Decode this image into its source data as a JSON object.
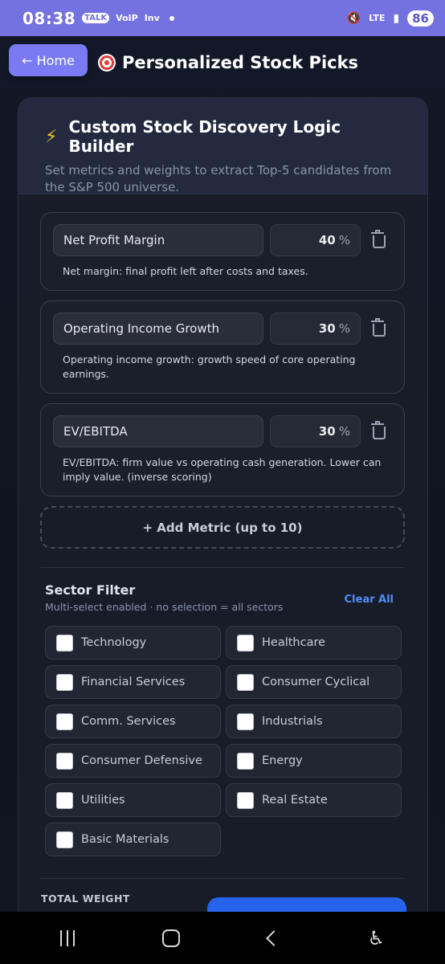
{
  "status_bar": {
    "time": "08:38",
    "notif_icons": [
      "TALK",
      "VoIP",
      "Inv"
    ],
    "network": "LTE",
    "battery": "86"
  },
  "header": {
    "home_label": "← Home",
    "title": "Personalized Stock Picks",
    "title_icon": "target-emoji"
  },
  "builder": {
    "title": "Custom Stock Discovery Logic Builder",
    "title_icon": "lightning-emoji",
    "subtitle": "Set metrics and weights to extract Top-5 candidates from the S&P 500 universe."
  },
  "metrics": [
    {
      "name": "Net Profit Margin",
      "weight": "40",
      "unit": "%",
      "description": "Net margin: final profit left after costs and taxes."
    },
    {
      "name": "Operating Income Growth",
      "weight": "30",
      "unit": "%",
      "description": "Operating income growth: growth speed of core operating earnings."
    },
    {
      "name": "EV/EBITDA",
      "weight": "30",
      "unit": "%",
      "description": "EV/EBITDA: firm value vs operating cash generation. Lower can imply value. (inverse scoring)"
    }
  ],
  "add_metric_label": "+ Add Metric (up to 10)",
  "sector_filter": {
    "title": "Sector Filter",
    "subtitle": "Multi-select enabled · no selection = all sectors",
    "clear_label": "Clear All",
    "sectors": [
      {
        "label": "Technology",
        "checked": false
      },
      {
        "label": "Healthcare",
        "checked": false
      },
      {
        "label": "Financial Services",
        "checked": false
      },
      {
        "label": "Consumer Cyclical",
        "checked": false
      },
      {
        "label": "Comm. Services",
        "checked": false
      },
      {
        "label": "Industrials",
        "checked": false
      },
      {
        "label": "Consumer Defensive",
        "checked": false
      },
      {
        "label": "Energy",
        "checked": false
      },
      {
        "label": "Utilities",
        "checked": false
      },
      {
        "label": "Real Estate",
        "checked": false
      },
      {
        "label": "Basic Materials",
        "checked": false
      }
    ]
  },
  "total_weight_label": "TOTAL WEIGHT",
  "colors": {
    "status_bar": "#7471e0",
    "home_button": "#7a7bf2",
    "accent_link": "#4f8ef5",
    "primary_button": "#2563eb",
    "lightning": "#f4c21c"
  }
}
